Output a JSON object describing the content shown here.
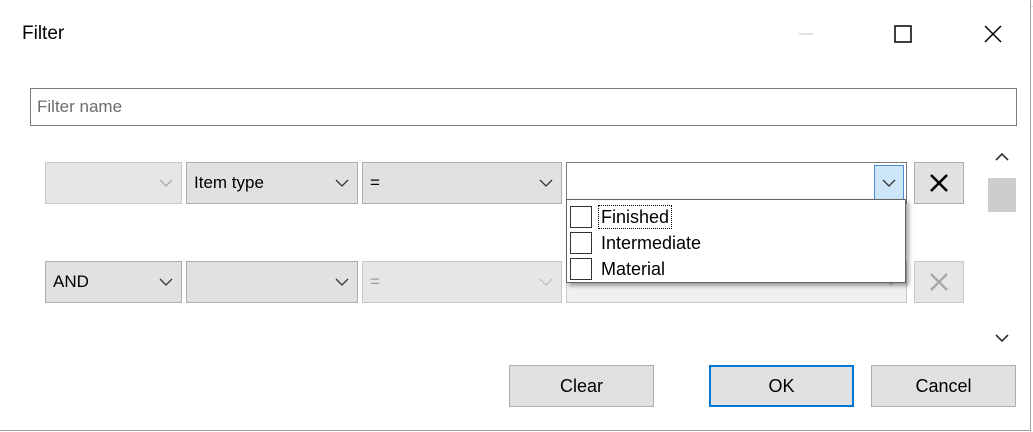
{
  "window": {
    "title": "Filter"
  },
  "filter_name": {
    "value": "",
    "placeholder": "Filter name"
  },
  "rows": [
    {
      "connector": "",
      "field": "Item type",
      "operator": "=",
      "value": ""
    },
    {
      "connector": "AND",
      "field": "",
      "operator": "=",
      "value": ""
    }
  ],
  "dropdown": {
    "options": [
      {
        "label": "Finished",
        "checked": false
      },
      {
        "label": "Intermediate",
        "checked": false
      },
      {
        "label": "Material",
        "checked": false
      }
    ]
  },
  "buttons": {
    "clear": "Clear",
    "ok": "OK",
    "cancel": "Cancel"
  },
  "colors": {
    "accent": "#0078d7",
    "button_face": "#e1e1e1",
    "dropdown_highlight": "#cde6f7"
  },
  "icons": {
    "minimize": "minimize-icon",
    "maximize": "maximize-icon",
    "close": "close-icon",
    "chevron": "chevron-down-icon",
    "delete": "x-icon",
    "scroll_up": "chevron-up-icon",
    "scroll_down": "chevron-down-icon"
  }
}
